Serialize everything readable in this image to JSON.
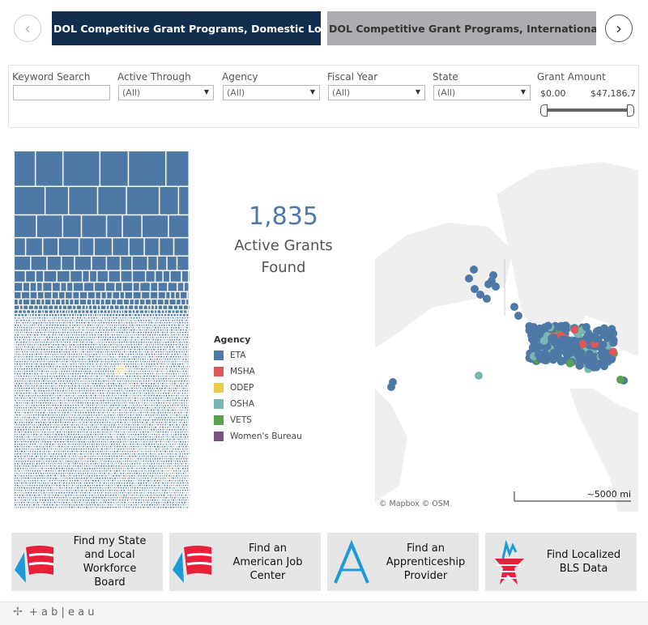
{
  "tabs": {
    "prev_label": "‹",
    "next_label": "›",
    "items": [
      {
        "label": "DOL Competitive Grant Programs, Domestic Locat...",
        "active": true
      },
      {
        "label": "DOL Competitive Grant Programs, International Ser...",
        "active": false
      }
    ]
  },
  "filters": {
    "keyword": {
      "label": "Keyword Search",
      "value": ""
    },
    "active_through": {
      "label": "Active Through",
      "value": "(All)"
    },
    "agency": {
      "label": "Agency",
      "value": "(All)"
    },
    "fiscal_year": {
      "label": "Fiscal Year",
      "value": "(All)"
    },
    "state": {
      "label": "State",
      "value": "(All)"
    },
    "grant_amount": {
      "label": "Grant Amount",
      "min": "$0.00",
      "max": "$47,186,7",
      "range_fraction": [
        0,
        1
      ]
    }
  },
  "summary": {
    "count": "1,835",
    "line1": "Active Grants",
    "line2": "Found"
  },
  "legend": {
    "title": "Agency",
    "items": [
      {
        "label": "ETA",
        "color": "#4e79a7"
      },
      {
        "label": "MSHA",
        "color": "#e15759"
      },
      {
        "label": "ODEP",
        "color": "#edc948"
      },
      {
        "label": "OSHA",
        "color": "#76b7b2"
      },
      {
        "label": "VETS",
        "color": "#59a14f"
      },
      {
        "label": "Women's Bureau",
        "color": "#7b5283"
      }
    ]
  },
  "map": {
    "attribution": "© Mapbox  © OSM",
    "scale_label": "~5000 mi"
  },
  "buttons": [
    {
      "label": "Find my State\nand Local Workforce\nBoard",
      "icon": "flag-icon"
    },
    {
      "label": "Find an\nAmerican Job Center",
      "icon": "flag-icon"
    },
    {
      "label": "Find an\nApprenticeship\nProvider",
      "icon": "apprenticeship-a-icon"
    },
    {
      "label": "Find Localized\nBLS Data",
      "icon": "bls-star-icon"
    }
  ],
  "footer": {
    "brand": "+ a b | e a u"
  }
}
